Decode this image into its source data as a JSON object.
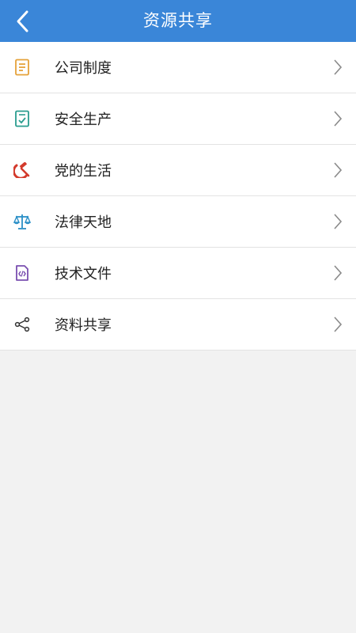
{
  "header": {
    "title": "资源共享",
    "background": "#3a86d8"
  },
  "menu": {
    "items": [
      {
        "label": "公司制度",
        "icon": "document-icon",
        "icon_color": "#e5a23a"
      },
      {
        "label": "安全生产",
        "icon": "checked-document-icon",
        "icon_color": "#2a9d8f"
      },
      {
        "label": "党的生活",
        "icon": "hammer-sickle-icon",
        "icon_color": "#d33a2c"
      },
      {
        "label": "法律天地",
        "icon": "scales-icon",
        "icon_color": "#2a8fc7"
      },
      {
        "label": "技术文件",
        "icon": "code-file-icon",
        "icon_color": "#7a4fb0"
      },
      {
        "label": "资料共享",
        "icon": "share-icon",
        "icon_color": "#333333"
      }
    ]
  }
}
